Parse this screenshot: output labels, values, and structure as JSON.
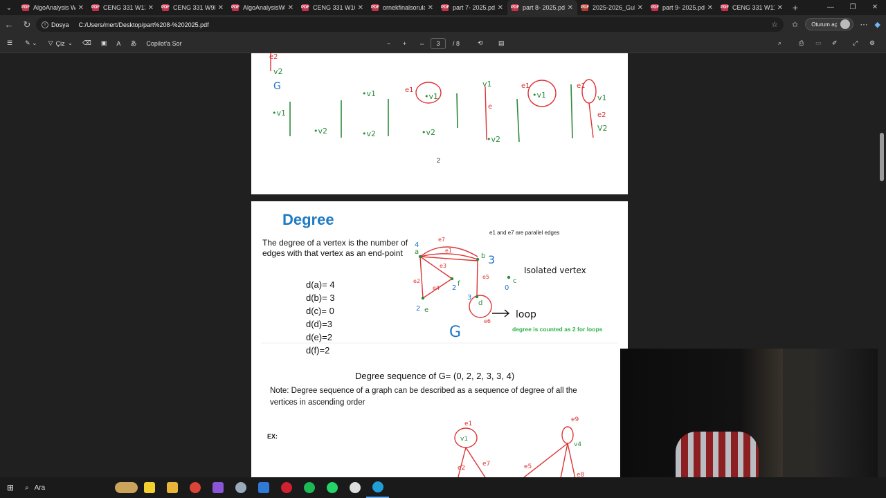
{
  "tabs": [
    {
      "title": "AlgoAnalysis W3",
      "color": "#c4314b"
    },
    {
      "title": "CENG 331 W12",
      "color": "#c4314b"
    },
    {
      "title": "CENG 331 W9L9",
      "color": "#c4314b"
    },
    {
      "title": "AlgoAnalysisW8",
      "color": "#c4314b"
    },
    {
      "title": "CENG 331 W10L",
      "color": "#c4314b"
    },
    {
      "title": "ornekfinalsorular",
      "color": "#c4314b"
    },
    {
      "title": "part 7- 2025.pdf",
      "color": "#c4314b"
    },
    {
      "title": "part 8- 2025.pdf",
      "color": "#c4314b",
      "active": true
    },
    {
      "title": "2025-2026_Gul",
      "color": "#b03a2e"
    },
    {
      "title": "part 9- 2025.pdf",
      "color": "#c4314b"
    },
    {
      "title": "CENG 331 W11L",
      "color": "#c4314b"
    }
  ],
  "addressbar": {
    "chip": "Dosya",
    "url": "C:/Users/mert/Desktop/part%208-%202025.pdf",
    "signin": "Oturum aç"
  },
  "pdf_toolbar": {
    "draw_label": "Çiz",
    "copilot_label": "Copilot'a Sor",
    "page_current": "3",
    "page_total": "/ 8"
  },
  "page1": {
    "page_number": "2"
  },
  "page2": {
    "title": "Degree",
    "definition": "The degree of a vertex is the number of edges with that vertex as an end-point",
    "degrees": [
      "d(a)= 4",
      "d(b)= 3",
      "d(c)= 0",
      "d(d)=3",
      "d(e)=2",
      "d(f)=2"
    ],
    "parallel_note": "e1 and e7 are parallel edges",
    "isolated_label": "Isolated vertex",
    "loop_label": "loop",
    "loop_note": "degree is counted as 2 for loops",
    "graph_label": "G",
    "sequence": "Degree sequence of G= (0, 2, 2, 3, 3, 4)",
    "note": "Note: Degree sequence of a graph can be described as a sequence of degree of all the vertices in ascending order",
    "ex_label": "EX:"
  },
  "taskbar": {
    "search_label": "Ara"
  }
}
